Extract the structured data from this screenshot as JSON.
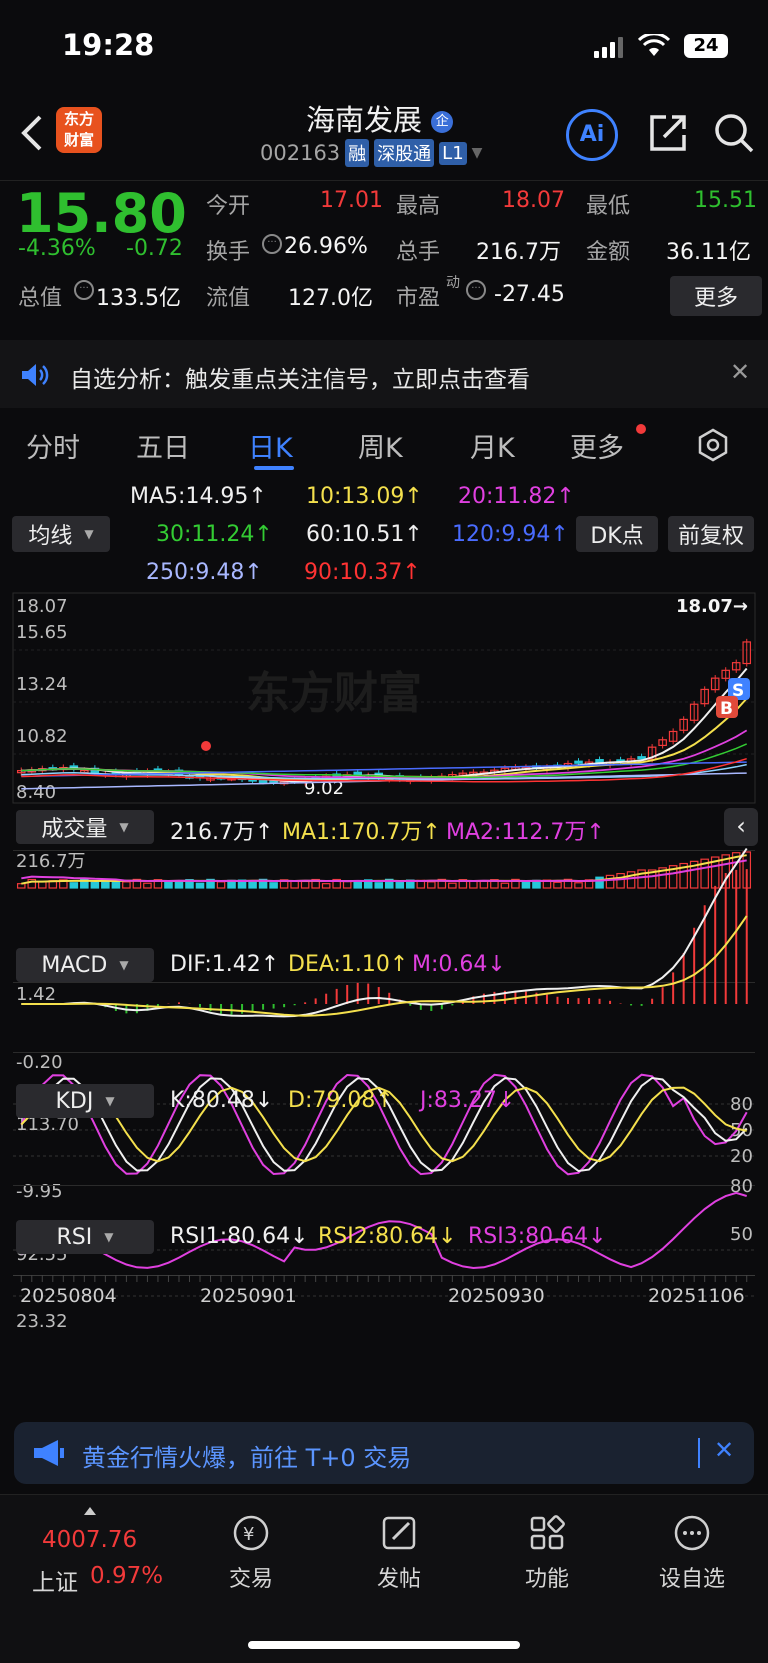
{
  "status": {
    "time": "19:28",
    "battery": "24"
  },
  "header": {
    "logo_line1": "东方",
    "logo_line2": "财富",
    "stock_name": "海南发展",
    "badge": "企",
    "code": "002163",
    "tag1": "融",
    "tag2": "深股通",
    "tag3": "L1",
    "ai": "Ai"
  },
  "quote": {
    "price": "15.80",
    "pct": "-4.36%",
    "chg": "-0.72",
    "open_l": "今开",
    "open_v": "17.01",
    "high_l": "最高",
    "high_v": "18.07",
    "low_l": "最低",
    "low_v": "15.51",
    "turn_l": "换手",
    "turn_v": "26.96%",
    "vol_l": "总手",
    "vol_v": "216.7万",
    "amt_l": "金额",
    "amt_v": "36.11亿",
    "mcap_l": "总值",
    "mcap_v": "133.5亿",
    "float_l": "流值",
    "float_v": "127.0亿",
    "pe_l": "市盈",
    "pe_sup": "动",
    "pe_v": "-27.45",
    "more": "更多"
  },
  "notice": {
    "text": "自选分析：触发重点关注信号，立即点击查看"
  },
  "tabs": [
    "分时",
    "五日",
    "日K",
    "周K",
    "月K",
    "更多"
  ],
  "ma": {
    "selector": "均线",
    "dk": "DK点",
    "fq": "前复权",
    "items": [
      {
        "t": "MA5:14.95↑",
        "c": "#f0f0f0"
      },
      {
        "t": "10:13.09↑",
        "c": "#f4e04d"
      },
      {
        "t": "20:11.82↑",
        "c": "#e040e0"
      },
      {
        "t": "30:11.24↑",
        "c": "#33cc33"
      },
      {
        "t": "60:10.51↑",
        "c": "#f0f0f0"
      },
      {
        "t": "120:9.94↑",
        "c": "#4a6cff"
      },
      {
        "t": "250:9.48↑",
        "c": "#a9b8ff"
      },
      {
        "t": "90:10.37↑",
        "c": "#ff3333"
      }
    ]
  },
  "kline": {
    "y1": "18.07",
    "y2": "15.65",
    "y3": "13.24",
    "y4": "10.82",
    "y5": "8.40",
    "high_mark": "18.07→",
    "low_mark": "9.02",
    "watermark": "东方财富",
    "s": "S",
    "b": "B"
  },
  "volume": {
    "selector": "成交量",
    "v": "216.7万↑",
    "ma1": "MA1:170.7万↑",
    "ma2": "MA2:112.7万↑",
    "y1": "216.7万"
  },
  "macd": {
    "selector": "MACD",
    "dif": "DIF:1.42↑",
    "dea": "DEA:1.10↑",
    "m": "M:0.64↓",
    "y1": "1.42",
    "y2": "-0.20"
  },
  "kdj": {
    "selector": "KDJ",
    "k": "K:80.48↓",
    "d": "D:79.08↑",
    "j": "J:83.27↓",
    "y1": "113.70",
    "y2": "-9.95",
    "r80": "80",
    "r50": "50",
    "r20": "20"
  },
  "rsi": {
    "selector": "RSI",
    "r1": "RSI1:80.64↓",
    "r2": "RSI2:80.64↓",
    "r3": "RSI3:80.64↓",
    "y1": "92.55",
    "y2": "23.32",
    "r80": "80",
    "r50": "50"
  },
  "dates": [
    "20250804",
    "20250901",
    "20250930",
    "20251106"
  ],
  "banner": {
    "text": "黄金行情火爆，前往 T+0 交易"
  },
  "nav": {
    "index_v": "4007.76",
    "index_n": "上证",
    "index_p": "0.97%",
    "trade": "交易",
    "post": "发帖",
    "func": "功能",
    "watch": "设自选"
  }
}
